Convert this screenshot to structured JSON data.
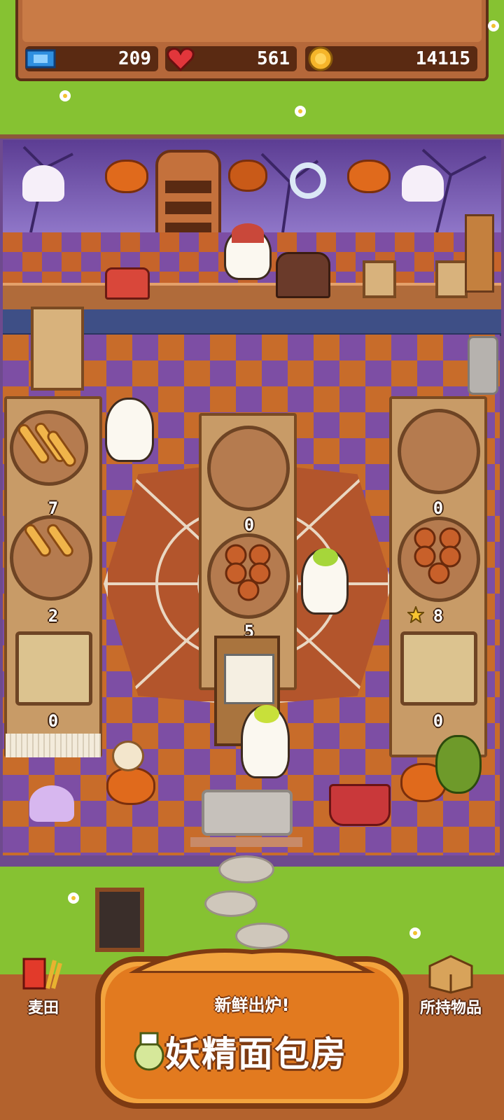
{
  "hud": {
    "tickets": "209",
    "hearts": "561",
    "coins": "14115"
  },
  "shop": {
    "left_shelf_counts": [
      "7",
      "2",
      "0"
    ],
    "center_shelf_counts": [
      "0",
      "5"
    ],
    "right_shelf_counts": [
      "0",
      "8",
      "0"
    ]
  },
  "nav": {
    "wheat_field": "麦田",
    "inventory": "所持物品"
  },
  "logo": {
    "tagline": "新鲜出炉!",
    "title": "妖精面包房"
  },
  "colors": {
    "wood": "#b5683a",
    "lawn": "#86c232",
    "purple_tile": "#7d4ea4",
    "orange_tile": "#c86c2a"
  }
}
